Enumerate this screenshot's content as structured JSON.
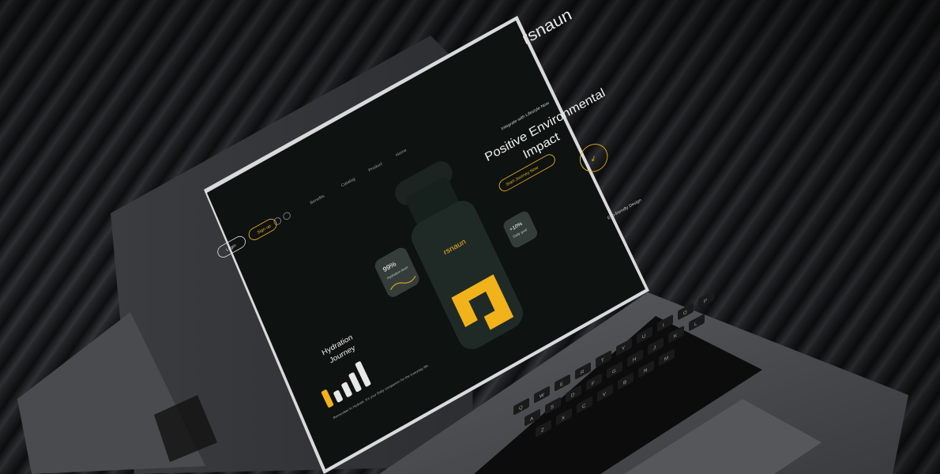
{
  "site": {
    "logo": "rsnaun",
    "tagline": "Integrate with Lifestyle Now",
    "nav": [
      "Home",
      "Product",
      "Catalog",
      "Benefits"
    ],
    "buttons": {
      "signup": "Sign up",
      "login": "Login"
    },
    "hero": {
      "title_line1": "Positive Environmental",
      "title_line2": "Impact",
      "cta": "Start Journey Now",
      "badge": "Eco-friendly Design"
    },
    "stats": {
      "left_card_value": "99%",
      "left_card_label": "Hydration level",
      "right_card_value": "+10%",
      "right_card_label": "Daily goal"
    },
    "journey": {
      "title_line1": "Hydration",
      "title_line2": "Journey",
      "body": "Remember to Hydrate. It's your Daily companion for the everyday life."
    },
    "bars": [
      0.55,
      0.35,
      0.45,
      0.6,
      0.8
    ],
    "colors": {
      "accent": "#f2b21a",
      "screen_bg": "#0e1211",
      "bottle": "#1f2a26"
    }
  },
  "keyboard_keys": [
    "Q",
    "W",
    "E",
    "R",
    "T",
    "Y",
    "U",
    "I",
    "O",
    "P",
    "A",
    "S",
    "D",
    "F",
    "G",
    "H",
    "J",
    "K",
    "L",
    "Z",
    "X",
    "C",
    "V",
    "B",
    "N",
    "M"
  ]
}
